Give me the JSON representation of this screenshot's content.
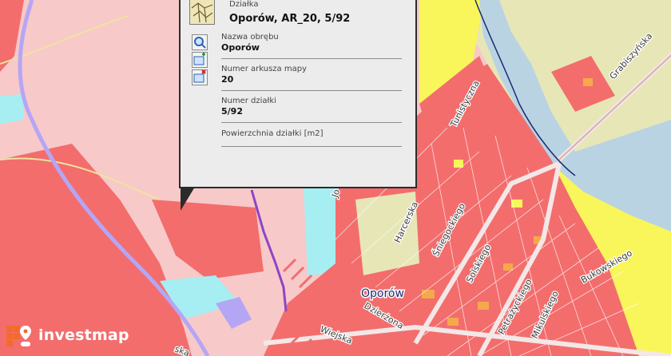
{
  "popup": {
    "title_label": "Działka",
    "title_value": "Oporów, AR_20, 5/92",
    "fields": [
      {
        "label": "Nazwa obrębu",
        "value": "Oporów"
      },
      {
        "label": "Numer arkusza mapy",
        "value": "20"
      },
      {
        "label": "Numer działki",
        "value": "5/92"
      },
      {
        "label": "Powierzchnia działki [m2]",
        "value": ""
      }
    ],
    "tools": [
      "zoom-to-parcel-icon",
      "add-layer-icon",
      "remove-layer-icon"
    ]
  },
  "map": {
    "district_label": "Oporów",
    "streets": [
      "Grabiszyńska",
      "Tunistyczna",
      "Harcerska",
      "Śniegockiego",
      "Solskiego",
      "Petrażyckiego",
      "Mikulskiego",
      "Bukowskiego",
      "Dzierżona",
      "Wiejska",
      "Jo"
    ],
    "colors": {
      "residential_red": "#f36d6d",
      "light_pink": "#f7c9c9",
      "yellow": "#f8f65a",
      "pale_green": "#e7e6b7",
      "water_blue": "#b9d3e3",
      "cyan": "#a6eef2",
      "orange": "#f5a94a",
      "purple_line": "#8e44c6",
      "lavender": "#b5a6f5"
    }
  },
  "brand": {
    "name": "investmap",
    "logo": "investmap-logo-icon"
  }
}
